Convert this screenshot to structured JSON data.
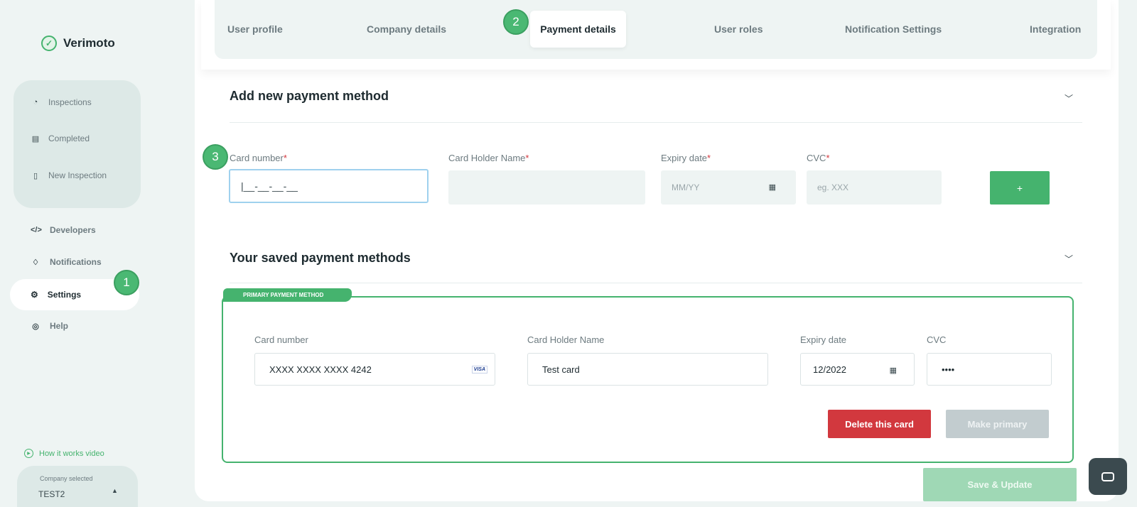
{
  "brand": {
    "name": "Verimoto"
  },
  "sidebar": {
    "group_items": [
      {
        "label": "Inspections",
        "icon": "inspections-icon"
      },
      {
        "label": "Completed",
        "icon": "completed-icon"
      },
      {
        "label": "New Inspection",
        "icon": "new-inspection-icon"
      }
    ],
    "links": [
      {
        "label": "Developers",
        "icon": "code-icon"
      },
      {
        "label": "Notifications",
        "icon": "bell-icon"
      },
      {
        "label": "Settings",
        "icon": "gear-icon"
      },
      {
        "label": "Help",
        "icon": "help-icon"
      }
    ],
    "how_it_works": "How it works video",
    "company_label": "Company selected",
    "company_value": "TEST2"
  },
  "badges": {
    "one": "1",
    "two": "2",
    "three": "3"
  },
  "tabs": [
    {
      "label": "User profile"
    },
    {
      "label": "Company details"
    },
    {
      "label": "Payment details"
    },
    {
      "label": "User roles"
    },
    {
      "label": "Notification Settings"
    },
    {
      "label": "Integration"
    }
  ],
  "add_section": {
    "title": "Add new payment method",
    "card_number_label": "Card number",
    "card_number_value": "|__-__-__-__",
    "holder_label": "Card Holder Name",
    "expiry_label": "Expiry date",
    "expiry_placeholder": "MM/YY",
    "cvc_label": "CVC",
    "cvc_placeholder": "eg. XXX",
    "required_mark": "*",
    "add_button": "+"
  },
  "saved_section": {
    "title": "Your saved payment methods",
    "primary_tag": "PRIMARY PAYMENT METHOD",
    "card_number_label": "Card number",
    "card_number_value": "XXXX XXXX XXXX 4242",
    "card_brand": "VISA",
    "holder_label": "Card Holder Name",
    "holder_value": "Test card",
    "expiry_label": "Expiry date",
    "expiry_value": "12/2022",
    "cvc_label": "CVC",
    "cvc_value": "••••",
    "delete_button": "Delete this card",
    "primary_button": "Make primary"
  },
  "save_button": "Save & Update",
  "colors": {
    "accent": "#45b36e",
    "danger": "#d2383e",
    "panel": "#eef4f3"
  }
}
